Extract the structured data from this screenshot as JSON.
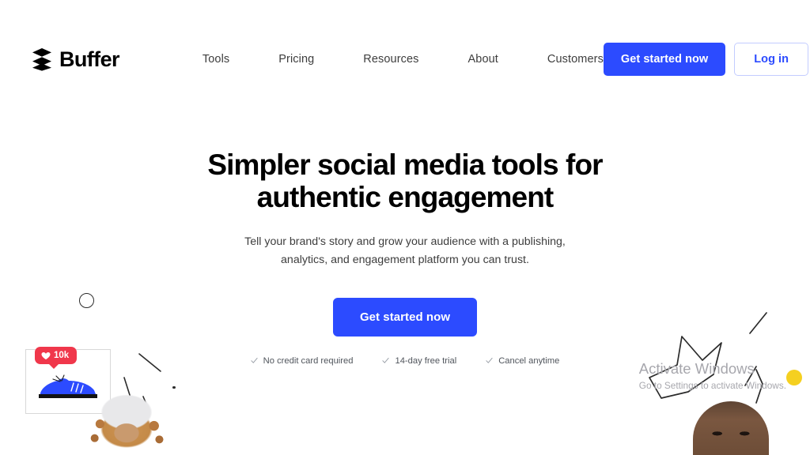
{
  "brand": {
    "name": "Buffer",
    "logo_icon": "stacked-layers-icon"
  },
  "nav": {
    "items": [
      {
        "label": "Tools"
      },
      {
        "label": "Pricing"
      },
      {
        "label": "Resources"
      },
      {
        "label": "About"
      },
      {
        "label": "Customers"
      }
    ]
  },
  "header_actions": {
    "get_started_label": "Get started now",
    "login_label": "Log in"
  },
  "hero": {
    "title": "Simpler social media tools for authentic engagement",
    "subtitle": "Tell your brand's story and grow your audience with a publishing, analytics, and engagement platform you can trust.",
    "cta_label": "Get started now",
    "trust_items": [
      {
        "icon": "check-icon",
        "label": "No credit card required"
      },
      {
        "icon": "check-icon",
        "label": "14-day free trial"
      },
      {
        "icon": "check-icon",
        "label": "Cancel anytime"
      }
    ]
  },
  "illustration_left": {
    "like_badge": {
      "icon": "heart-icon",
      "count": "10k"
    },
    "photo_frame_icon": "sneaker-photo-icon",
    "circle_icon": "circle-outline-icon",
    "dot_icon": "dot-icon",
    "person_icon": "person-curly-hair-icon"
  },
  "illustration_right": {
    "star_icon": "star-outline-icon",
    "person_icon": "person-smiling-icon",
    "dot_icon": "yellow-dot-icon"
  },
  "watermark": {
    "title": "Activate Windows",
    "subtitle": "Go to Settings to activate Windows."
  },
  "colors": {
    "brand_blue": "#2C4BFF",
    "badge_red": "#F0374B",
    "accent_yellow": "#F5D020",
    "text_dark": "#000000",
    "text_body": "#3D3D3D",
    "watermark_gray": "#A7A7AD"
  }
}
